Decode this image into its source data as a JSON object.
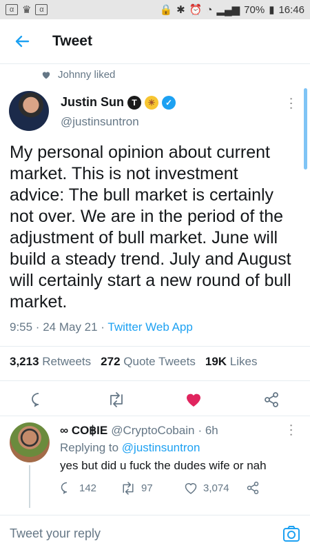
{
  "status_bar": {
    "left_icons": [
      "α",
      "crown-icon",
      "α"
    ],
    "battery": "70%",
    "time": "16:46"
  },
  "header": {
    "title": "Tweet"
  },
  "social_context": {
    "text": "Johnny liked"
  },
  "tweet": {
    "author_name": "Justin Sun",
    "handle": "@justinsuntron",
    "text": "My personal opinion about current market. This is not investment advice: The bull market is certainly not over. We are in the period of the adjustment of bull market. June will build a steady trend. July and August will certainly start a new round of bull market.",
    "time": "9:55 · 24 May 21 · ",
    "source": "Twitter Web App",
    "retweets_count": "3,213",
    "retweets_label": "Retweets",
    "quotes_count": "272",
    "quotes_label": "Quote Tweets",
    "likes_count": "19K",
    "likes_label": "Likes"
  },
  "reply": {
    "name": "∞ CO฿IE",
    "handle": "@CryptoCobain",
    "age": "· 6h",
    "replying_prefix": "Replying to ",
    "replying_to": "@justinsuntron",
    "text": "yes but did u fuck the dudes wife or nah",
    "replies": "142",
    "retweets": "97",
    "likes": "3,074"
  },
  "composer": {
    "placeholder": "Tweet your reply"
  },
  "colors": {
    "accent": "#1da1f2",
    "like": "#e0245e",
    "muted": "#657786"
  }
}
